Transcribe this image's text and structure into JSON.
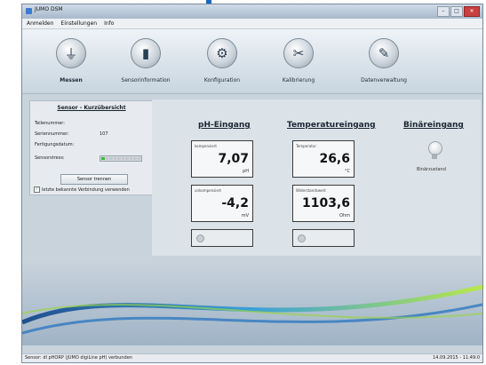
{
  "window": {
    "title": "JUMO DSM",
    "controls": {
      "minimize": "–",
      "maximize": "□",
      "close": "✕"
    }
  },
  "menu": [
    "Anmelden",
    "Einstellungen",
    "Info"
  ],
  "toolbar": [
    {
      "label": "Messen",
      "icon": "probe-icon",
      "glyph": "⏚",
      "active": true
    },
    {
      "label": "Sensorinformation",
      "icon": "sensor-info-icon",
      "glyph": "▮",
      "active": false
    },
    {
      "label": "Konfiguration",
      "icon": "gears-icon",
      "glyph": "⚙",
      "active": false
    },
    {
      "label": "Kalibrierung",
      "icon": "tools-icon",
      "glyph": "✂",
      "active": false
    },
    {
      "label": "Datenverwaltung",
      "icon": "document-pen-icon",
      "glyph": "✎",
      "active": false
    }
  ],
  "sensor_panel": {
    "title": "Sensor - Kurzübersicht",
    "rows": [
      {
        "label": "Teilenummer:",
        "value": ""
      },
      {
        "label": "Seriennummer:",
        "value": "107"
      },
      {
        "label": "Fertigungsdatum:",
        "value": ""
      },
      {
        "label": "Sensorstress:",
        "value": ""
      }
    ],
    "stress_level_fraction": 0.1,
    "button": "Sensor trennen",
    "checkbox_label": "letzte bekannte Verbindung verwenden",
    "checkbox_checked": true
  },
  "columns": {
    "ph": {
      "title": "pH-Eingang",
      "value_box": {
        "label": "kompensiert",
        "value": "7,07",
        "unit": "pH"
      },
      "raw_box": {
        "label": "unkompensiert",
        "value": "-4,2",
        "unit": "mV"
      }
    },
    "temp": {
      "title": "Temperatureingang",
      "value_box": {
        "label": "Temperatur",
        "value": "26,6",
        "unit": "°C"
      },
      "raw_box": {
        "label": "Widerstandswert",
        "value": "1103,6",
        "unit": "Ohm"
      }
    },
    "binary": {
      "title": "Binäreingang",
      "state_label": "Binärzustand"
    }
  },
  "statusbar": {
    "left": "Sensor: dl pHORP (JUMO digiLine pH) verbunden",
    "right": "14.09.2015 - 11:49:0"
  },
  "colors": {
    "accent": "#1468c8",
    "led_on": "#2fc12f",
    "panel": "#dbe2e8"
  }
}
